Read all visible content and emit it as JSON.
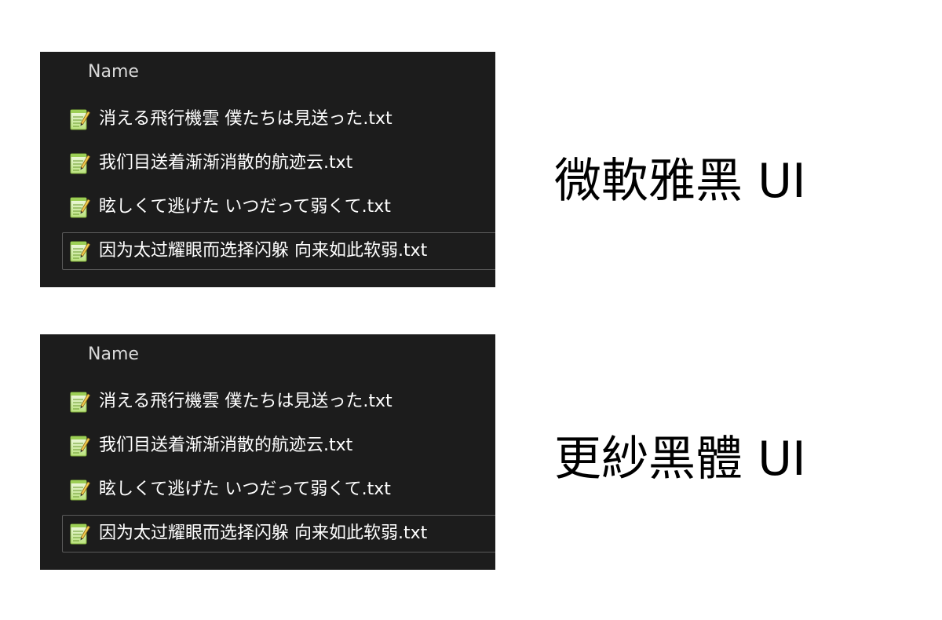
{
  "panels": [
    {
      "column_header": "Name",
      "files": [
        {
          "name": "消える飛行機雲 僕たちは見送った.txt",
          "icon": "notepad-file-icon"
        },
        {
          "name": "我们目送着渐渐消散的航迹云.txt",
          "icon": "notepad-file-icon"
        },
        {
          "name": "眩しくて逃げた いつだって弱くて.txt",
          "icon": "notepad-file-icon"
        },
        {
          "name": "因为太过耀眼而选择闪躲 向来如此软弱.txt",
          "icon": "notepad-file-icon",
          "focused": true
        }
      ],
      "caption": "微軟雅黑 UI"
    },
    {
      "column_header": "Name",
      "files": [
        {
          "name": "消える飛行機雲 僕たちは見送った.txt",
          "icon": "notepad-file-icon"
        },
        {
          "name": "我们目送着渐渐消散的航迹云.txt",
          "icon": "notepad-file-icon"
        },
        {
          "name": "眩しくて逃げた いつだって弱くて.txt",
          "icon": "notepad-file-icon"
        },
        {
          "name": "因为太过耀眼而选择闪躲 向来如此软弱.txt",
          "icon": "notepad-file-icon",
          "focused": true
        }
      ],
      "caption": "更紗黑體 UI"
    }
  ],
  "colors": {
    "panel_background": "#1c1c1c",
    "file_text": "#ffffff",
    "header_text": "#d9d9d9",
    "focus_border": "#5a5a5a",
    "caption_text": "#000000"
  }
}
